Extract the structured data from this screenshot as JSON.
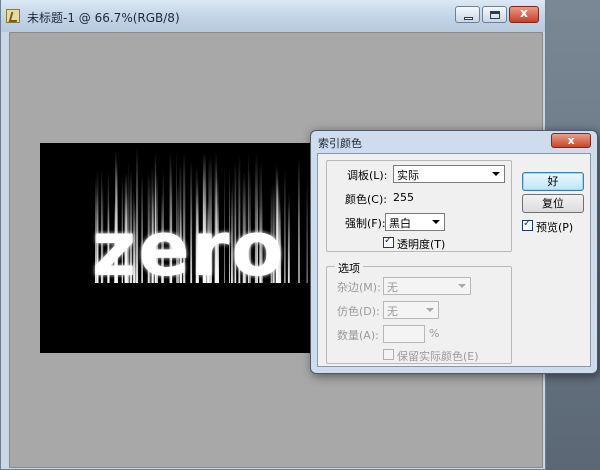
{
  "document": {
    "title": "未标题-1 @ 66.7%(RGB/8)",
    "canvas_text": "zero"
  },
  "dialog": {
    "title": "索引颜色",
    "close": "x",
    "palette_label": "调板(L):",
    "palette_value": "实际",
    "colors_label": "颜色(C):",
    "colors_value": "255",
    "forced_label": "强制(F):",
    "forced_value": "黑白",
    "transparency_label": "透明度(T)",
    "transparency_checked": true,
    "options_legend": "选项",
    "matte_label": "杂边(M):",
    "matte_value": "无",
    "dither_label": "仿色(D):",
    "dither_value": "无",
    "amount_label": "数量(A):",
    "amount_unit": "%",
    "preserve_label": "保留实际颜色(E)",
    "ok_label": "好",
    "reset_label": "复位",
    "preview_label": "预览(P)",
    "preview_checked": true
  }
}
